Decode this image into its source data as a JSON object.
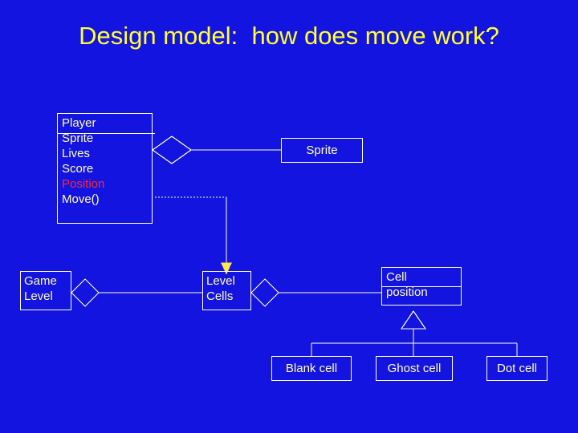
{
  "slide": {
    "background_color": "#1414e0",
    "title": "Design model:  how does move work?",
    "title_color": "#FFFF33",
    "line_color": "#FFFFE0",
    "text_color": "#FFFFC0",
    "highlight_color": "#FF2A2A"
  },
  "classes": {
    "player": {
      "name": "Player",
      "members": [
        {
          "label": "Sprite",
          "highlighted": false
        },
        {
          "label": "Lives",
          "highlighted": false
        },
        {
          "label": "Score",
          "highlighted": false
        },
        {
          "label": "Position",
          "highlighted": true
        },
        {
          "label": "Move()",
          "highlighted": false
        }
      ]
    },
    "sprite": {
      "name": "Sprite"
    },
    "game_level": {
      "line1": "Game",
      "line2": "Level"
    },
    "level_cells": {
      "line1": "Level",
      "line2": "Cells"
    },
    "cell_position": {
      "name": "Cell",
      "member": "position"
    },
    "blank_cell": {
      "name": "Blank cell"
    },
    "ghost_cell": {
      "name": "Ghost cell"
    },
    "dot_cell": {
      "name": "Dot cell"
    }
  },
  "relationships": [
    {
      "kind": "aggregation",
      "from": "Player",
      "to": "Sprite",
      "notation": "diamond"
    },
    {
      "kind": "dependency",
      "from": "Player",
      "to": "Level Cells",
      "notation": "dotted-line-with-arrow"
    },
    {
      "kind": "aggregation",
      "from": "Game Level",
      "to": "Level Cells",
      "notation": "diamond"
    },
    {
      "kind": "aggregation",
      "from": "Level Cells",
      "to": "Cell position",
      "notation": "diamond"
    },
    {
      "kind": "generalization",
      "from": "Blank cell",
      "to": "Cell position",
      "notation": "hollow-triangle"
    },
    {
      "kind": "generalization",
      "from": "Ghost cell",
      "to": "Cell position",
      "notation": "hollow-triangle"
    },
    {
      "kind": "generalization",
      "from": "Dot cell",
      "to": "Cell position",
      "notation": "hollow-triangle"
    }
  ]
}
